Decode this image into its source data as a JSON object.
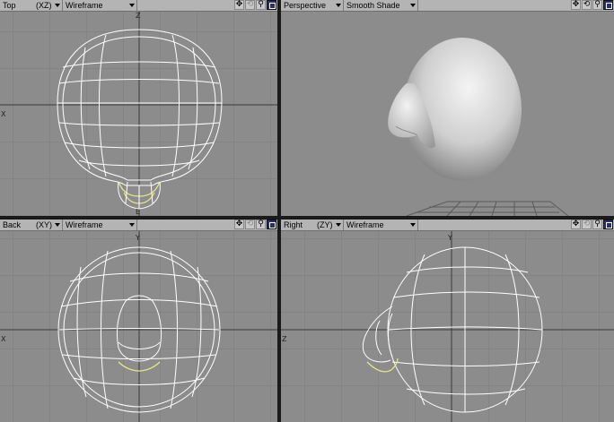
{
  "viewports": {
    "top": {
      "view": "Top",
      "axes": "(XZ)",
      "mode": "Wireframe"
    },
    "perspective": {
      "view": "Perspective",
      "mode": "Smooth Shade"
    },
    "back": {
      "view": "Back",
      "axes": "(XY)",
      "mode": "Wireframe"
    },
    "right": {
      "view": "Right",
      "axes": "(ZY)",
      "mode": "Wireframe"
    }
  },
  "icons": [
    "move-view-icon",
    "rotate-view-icon",
    "zoom-view-icon",
    "maximize-viewport-icon"
  ],
  "colors": {
    "viewport_bg": "#8c8c8c",
    "grid": "#7c7c7c",
    "wire": "#ffffff",
    "selected_wire": "#e6e68c",
    "header_bg": "#b4b4b4"
  }
}
